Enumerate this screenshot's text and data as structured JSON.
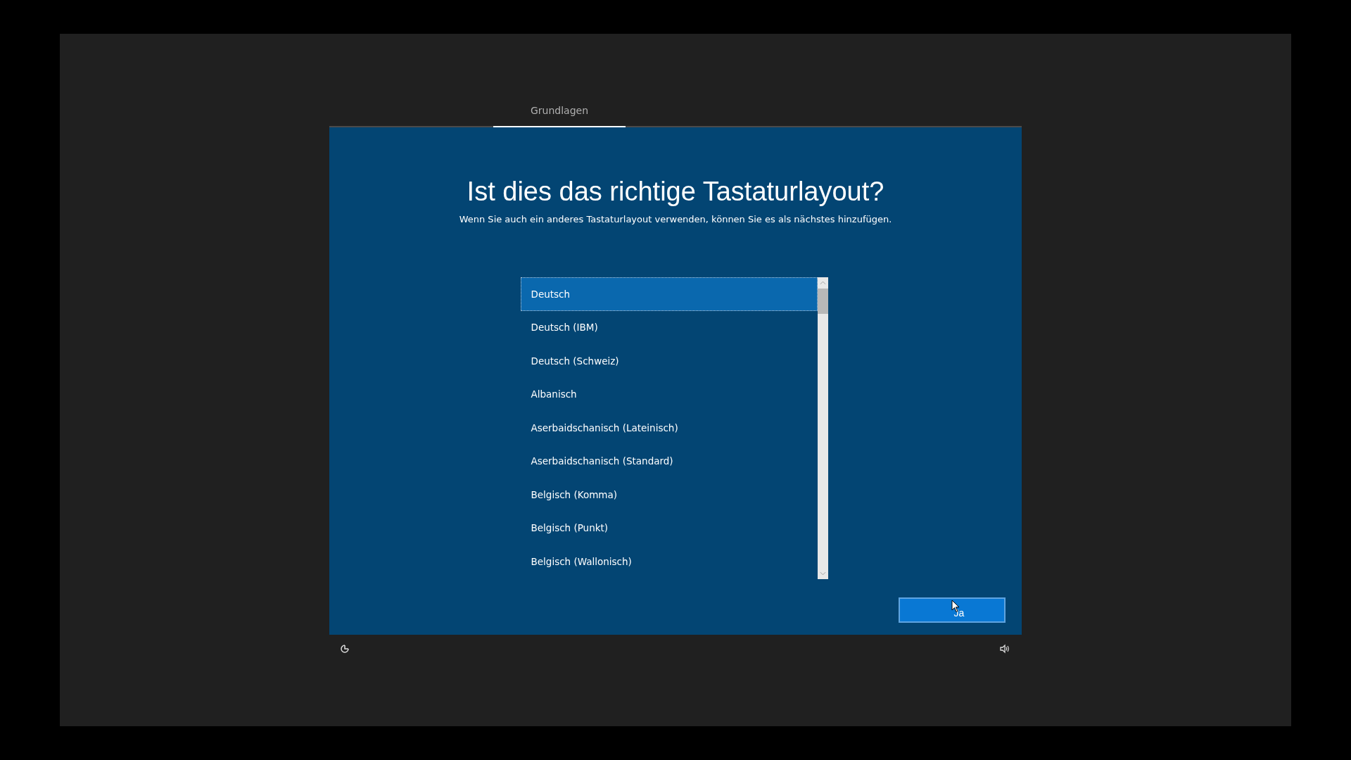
{
  "tabs": [
    {
      "label": "Grundlagen",
      "selected": true
    }
  ],
  "title": "Ist dies das richtige Tastaturlayout?",
  "subtitle": "Wenn Sie auch ein anderes Tastaturlayout verwenden, können Sie es als nächstes hinzufügen.",
  "layouts": [
    {
      "label": "Deutsch",
      "selected": true
    },
    {
      "label": "Deutsch (IBM)",
      "selected": false
    },
    {
      "label": "Deutsch (Schweiz)",
      "selected": false
    },
    {
      "label": "Albanisch",
      "selected": false
    },
    {
      "label": "Aserbaidschanisch (Lateinisch)",
      "selected": false
    },
    {
      "label": "Aserbaidschanisch (Standard)",
      "selected": false
    },
    {
      "label": "Belgisch (Komma)",
      "selected": false
    },
    {
      "label": "Belgisch (Punkt)",
      "selected": false
    },
    {
      "label": "Belgisch (Wallonisch)",
      "selected": false
    }
  ],
  "primary_button": {
    "label": "Ja"
  }
}
